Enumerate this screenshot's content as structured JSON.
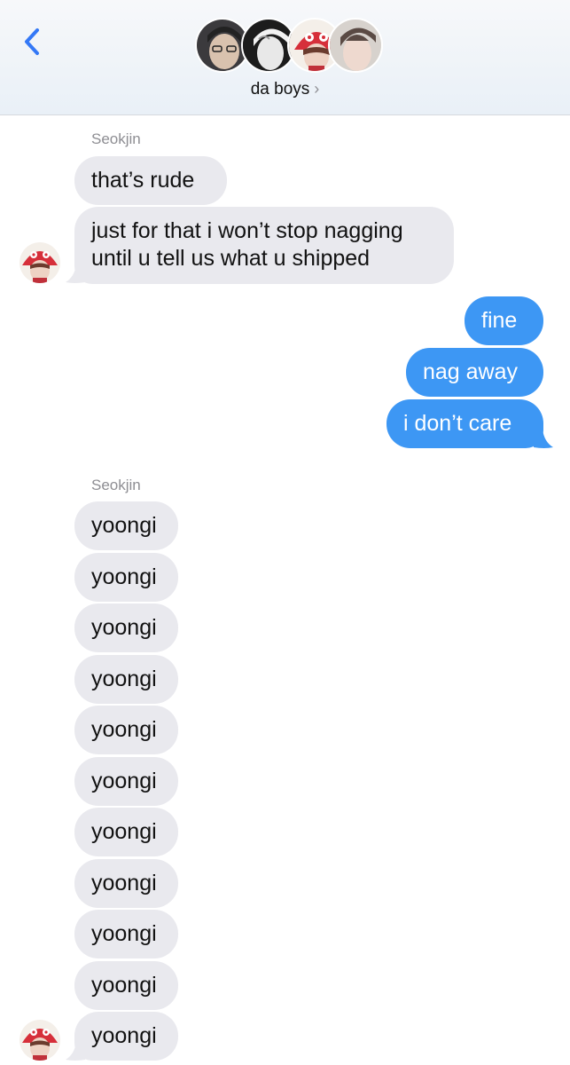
{
  "header": {
    "group_name": "da boys",
    "chevron": "›",
    "back_icon": "chevron-left-icon",
    "accent_color": "#3478f6"
  },
  "messages": [
    {
      "sender_label": "Seokjin"
    },
    {
      "text": "that’s rude",
      "direction": "in"
    },
    {
      "line1": "just for that i won’t stop nagging",
      "line2": "until u tell us what u shipped",
      "direction": "in"
    },
    {
      "text": "fine",
      "direction": "out"
    },
    {
      "text": "nag away",
      "direction": "out"
    },
    {
      "text": "i don’t care",
      "direction": "out"
    },
    {
      "sender_label": "Seokjin"
    },
    {
      "text": "yoongi",
      "direction": "in"
    },
    {
      "text": "yoongi",
      "direction": "in"
    },
    {
      "text": "yoongi",
      "direction": "in"
    },
    {
      "text": "yoongi",
      "direction": "in"
    },
    {
      "text": "yoongi",
      "direction": "in"
    },
    {
      "text": "yoongi",
      "direction": "in"
    },
    {
      "text": "yoongi",
      "direction": "in"
    },
    {
      "text": "yoongi",
      "direction": "in"
    },
    {
      "text": "yoongi",
      "direction": "in"
    },
    {
      "text": "yoongi",
      "direction": "in"
    },
    {
      "text": "yoongi",
      "direction": "in"
    }
  ],
  "colors": {
    "incoming_bubble": "#e9e9ee",
    "outgoing_bubble": "#3d97f4",
    "sender_label": "#8e8e93"
  }
}
